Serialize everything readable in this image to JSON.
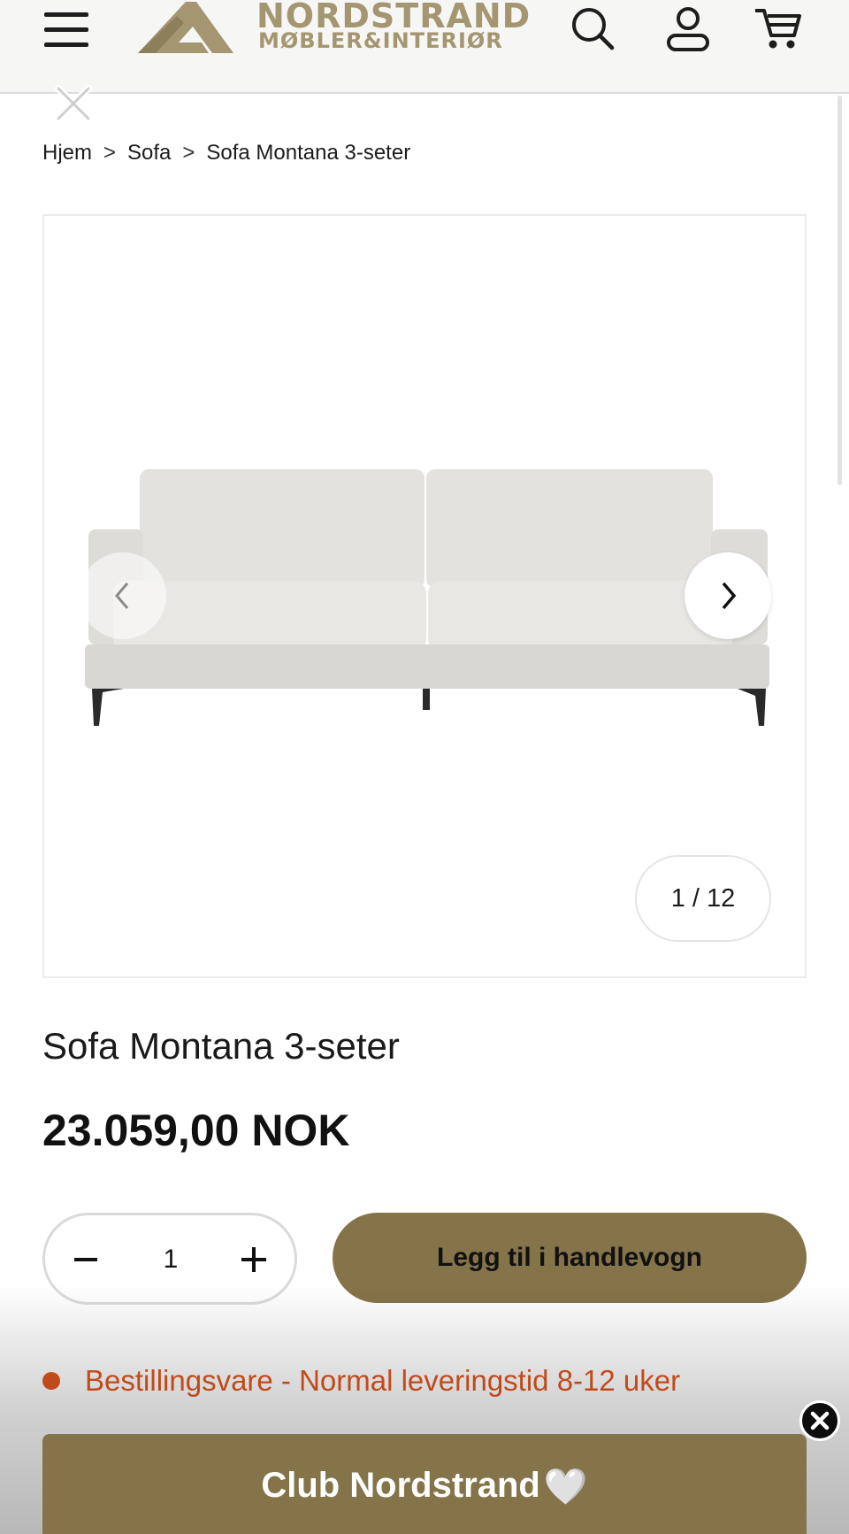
{
  "header": {
    "logo": {
      "title": "NORDSTRAND",
      "subtitle": "MØBLER&INTERIØR"
    },
    "icons": [
      "menu-icon",
      "search-icon",
      "account-icon",
      "cart-icon"
    ],
    "brand_color": "#a49670"
  },
  "breadcrumb": [
    "Hjem",
    "Sofa",
    "Sofa Montana 3-seter"
  ],
  "gallery": {
    "counter": "1 / 12",
    "current_image": 1,
    "total_images": 12
  },
  "product": {
    "title": "Sofa Montana 3-seter",
    "price": "23.059,00 NOK",
    "quantity": "1",
    "add_to_cart_label": "Legg til i handlevogn",
    "stock_status": "Bestillingsvare - Normal leveringstid 8-12 uker"
  },
  "promo": {
    "label": "Club Nordstrand",
    "heart": "🤍"
  },
  "colors": {
    "accent": "#857349",
    "stock_status": "#e0561f"
  }
}
